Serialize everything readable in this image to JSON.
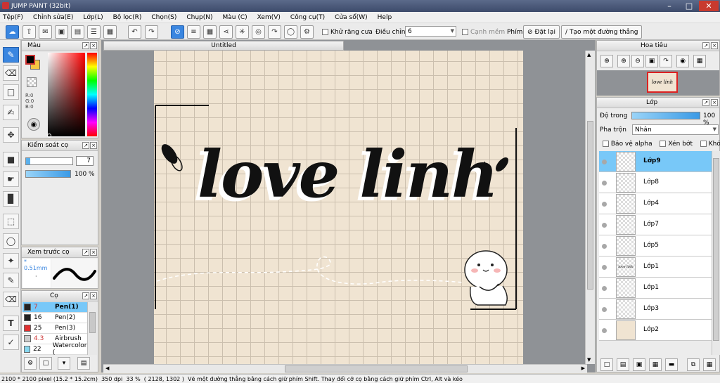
{
  "window": {
    "title": "JUMP PAINT (32bit)"
  },
  "menu": [
    "Tệp(F)",
    "Chỉnh sửa(E)",
    "Lớp(L)",
    "Bộ lọc(R)",
    "Chọn(S)",
    "Chụp(N)",
    "Màu (C)",
    "Xem(V)",
    "Công cụ(T)",
    "Cửa sổ(W)",
    "Help"
  ],
  "toolbar": {
    "antialias_label": "Khử răng cưa",
    "correction_label": "Điều chỉnh",
    "correction_value": "6",
    "edge_label": "Cạnh mềm",
    "key_label": "Phím",
    "reset_label": "Đặt lại",
    "straight_line_label": "Tạo một đường thẳng"
  },
  "color_panel": {
    "title": "Màu",
    "r": "R:0",
    "g": "G:0",
    "b": "B:0",
    "fg": "#000000",
    "bg": "#f4c542"
  },
  "brush_control": {
    "title": "Kiểm soát cọ",
    "size": "7",
    "opacity": "100 %",
    "opacity_level": 1.0
  },
  "brush_preview": {
    "title": "Xem trước cọ",
    "size": "0.51mm"
  },
  "brushes": {
    "title": "Cọ",
    "items": [
      {
        "size": "7",
        "name": "Pen(1)",
        "color": "#222222",
        "selected": true
      },
      {
        "size": "16",
        "name": "Pen(2)",
        "color": "#222222",
        "selected": false
      },
      {
        "size": "25",
        "name": "Pen(3)",
        "color": "#e03030",
        "selected": false
      },
      {
        "size": "4.3",
        "name": "Airbrush",
        "color": "#cccccc",
        "selected": false
      },
      {
        "size": "22",
        "name": "Watercolor (",
        "color": "#88d8f0",
        "selected": false
      }
    ]
  },
  "document": {
    "tab": "Untitled",
    "artwork_text": "love linh"
  },
  "navigator": {
    "title": "Hoa tiêu",
    "thumb_text": "love linh"
  },
  "layers": {
    "title": "Lớp",
    "opacity_label": "Độ trong",
    "opacity_value": "100 %",
    "opacity_level": 1.0,
    "blend_label": "Pha trộn",
    "blend_value": "Nhân",
    "protect_alpha": "Bảo vệ alpha",
    "clipping": "Xén bớt",
    "lock": "Khóa",
    "items": [
      {
        "name": "Lớp9",
        "selected": true,
        "thumb": ""
      },
      {
        "name": "Lớp8",
        "selected": false,
        "thumb": ""
      },
      {
        "name": "Lớp4",
        "selected": false,
        "thumb": ""
      },
      {
        "name": "Lớp7",
        "selected": false,
        "thumb": ""
      },
      {
        "name": "Lớp5",
        "selected": false,
        "thumb": ""
      },
      {
        "name": "Lớp1",
        "selected": false,
        "thumb": "love linh"
      },
      {
        "name": "Lớp1",
        "selected": false,
        "thumb": ""
      },
      {
        "name": "Lớp3",
        "selected": false,
        "thumb": ""
      },
      {
        "name": "Lớp2",
        "selected": false,
        "thumb": ""
      }
    ]
  },
  "status": {
    "dimensions": "2100 * 2100 pixel",
    "physical": "(15.2 * 15.2cm)",
    "dpi": "350 dpi",
    "zoom": "33 %",
    "coords": "( 2128, 1302 )",
    "hint": "Vẽ một đường thẳng bằng cách giữ phím Shift. Thay đổi cỡ cọ bằng cách giữ phím Ctrl, Alt và kéo"
  },
  "icons": [
    "pen-icon",
    "eraser-icon",
    "select-rect-icon",
    "hand-icon",
    "move-icon",
    "fill-icon",
    "bucket-icon",
    "gradient-icon",
    "lasso-icon",
    "magic-wand-icon",
    "text-icon",
    "eyedropper-icon"
  ]
}
